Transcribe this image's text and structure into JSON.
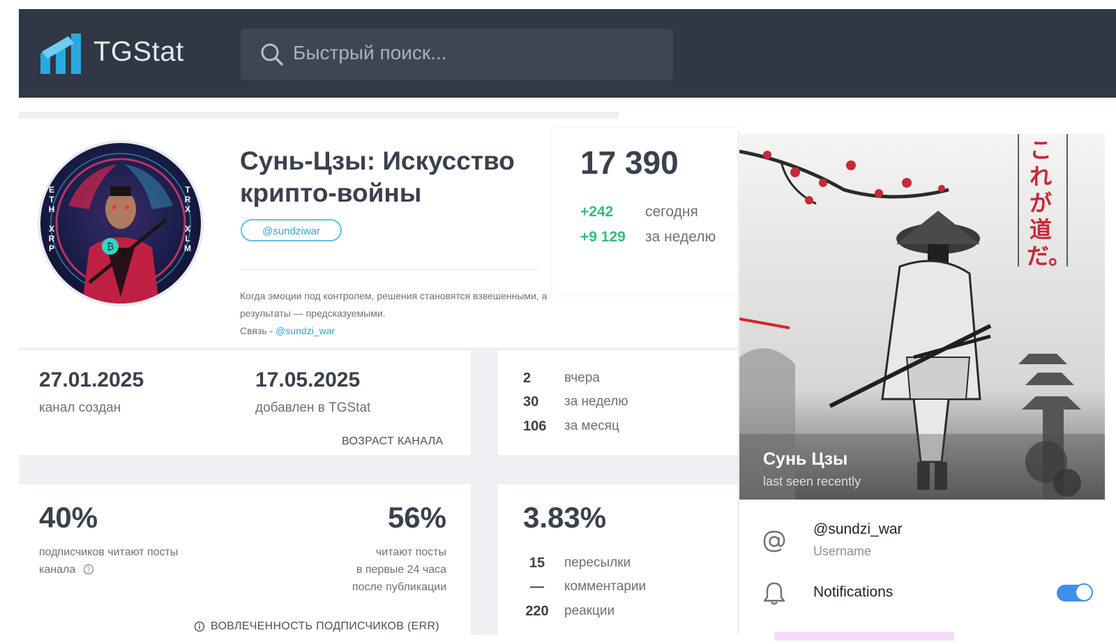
{
  "header": {
    "logo_text": "TGStat",
    "search_placeholder": "Быстрый поиск..."
  },
  "channel": {
    "title_line1": "Сунь-Цзы: Искусство",
    "title_line2": "крипто-войны",
    "handle": "@sundziwar",
    "description_line1": "Когда эмоции под контролем, решения становятся взвешенными, а",
    "description_line2": "результаты — предсказуемыми.",
    "contact_label": "Связь - ",
    "contact_link": "@sundzi_war",
    "avatar_letters_left": [
      "E",
      "T",
      "H",
      "",
      "X",
      "R",
      "P"
    ],
    "avatar_letters_right": [
      "T",
      "R",
      "X",
      "",
      "X",
      "L",
      "M"
    ]
  },
  "subscribers": {
    "count": "17 390",
    "today_value": "+242",
    "today_label": "сегодня",
    "week_value": "+9 129",
    "week_label": "за неделю"
  },
  "age": {
    "created_date": "27.01.2025",
    "created_label": "канал создан",
    "added_date": "17.05.2025",
    "added_label": "добавлен в TGStat",
    "section_label": "ВОЗРАСТ КАНАЛА"
  },
  "posts": [
    {
      "value": "2",
      "label": "вчера"
    },
    {
      "value": "30",
      "label": "за неделю"
    },
    {
      "value": "106",
      "label": "за месяц"
    }
  ],
  "engagement": {
    "read_pct": "40%",
    "read_label_line1": "подписчиков читают посты",
    "read_label_line2": "канала",
    "first24_pct": "56%",
    "first24_line1": "читают посты",
    "first24_line2": "в первые 24 часа",
    "first24_line3": "после публикации",
    "section_label": "ВОВЛЕЧЕННОСТЬ ПОДПИСЧИКОВ (ERR)"
  },
  "er": {
    "value": "3.83%",
    "rows": [
      {
        "value": "15",
        "label": "пересылки"
      },
      {
        "value": "—",
        "label": "комментарии"
      },
      {
        "value": "220",
        "label": "реакции"
      }
    ]
  },
  "telegram_profile": {
    "name": "Сунь Цзы",
    "status": "last seen recently",
    "username": "@sundzi_war",
    "username_label": "Username",
    "notifications_label": "Notifications",
    "notifications_on": true,
    "vertical_text": "これが道だ。"
  },
  "colors": {
    "navbar": "#2f3844",
    "accent_blue": "#2ba9cf",
    "positive_green": "#2ec07a",
    "toggle_blue": "#3e8ff0"
  }
}
